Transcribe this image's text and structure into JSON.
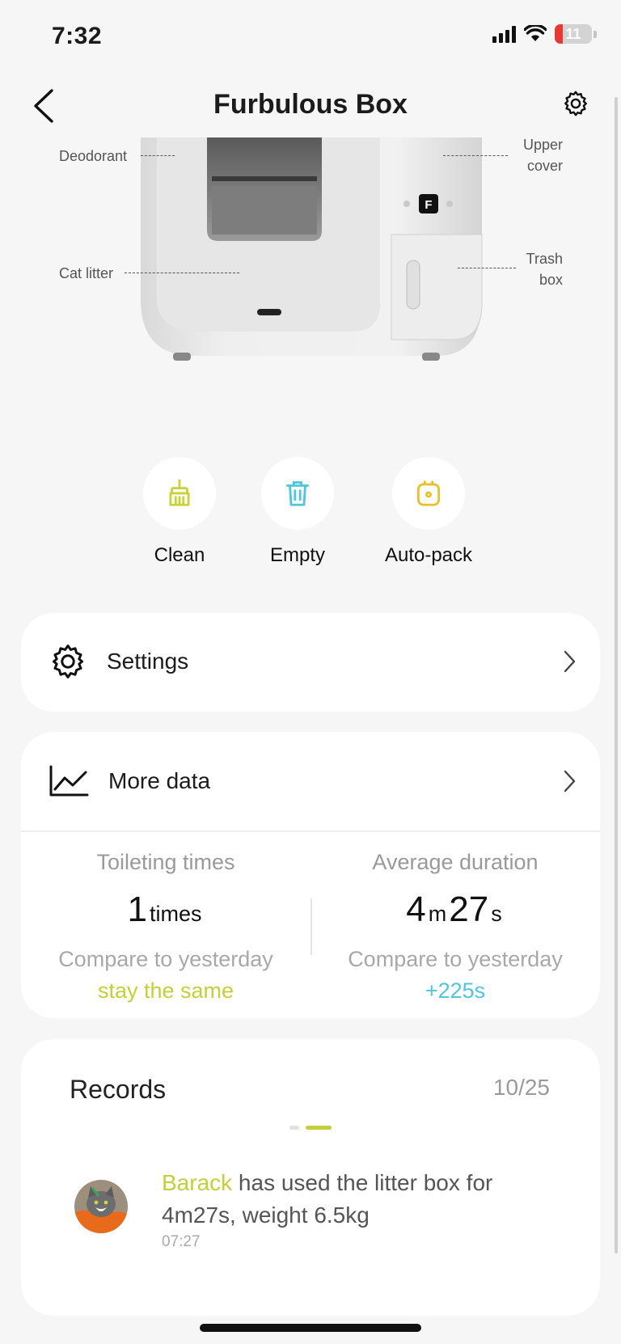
{
  "status": {
    "time": "7:32",
    "battery": "11"
  },
  "nav": {
    "title": "Furbulous Box"
  },
  "product": {
    "labels": {
      "deodorant": "Deodorant",
      "cat_litter": "Cat litter",
      "upper_cover": "Upper cover",
      "trash_box": "Trash box"
    },
    "panel_letter": "F"
  },
  "actions": [
    {
      "label": "Clean",
      "icon": "broom-icon",
      "color": "#c8d23a"
    },
    {
      "label": "Empty",
      "icon": "trash-icon",
      "color": "#4fc6da"
    },
    {
      "label": "Auto-pack",
      "icon": "auto-pack-icon",
      "color": "#e8c02e"
    }
  ],
  "menu": {
    "settings_label": "Settings",
    "more_data_label": "More data"
  },
  "stats": {
    "toileting": {
      "title": "Toileting times",
      "value": "1",
      "unit": "times",
      "compare": "Compare to yesterday",
      "delta": "stay the same",
      "delta_color": "#c4cf3a"
    },
    "duration": {
      "title": "Average duration",
      "minutes": "4",
      "minutes_unit": "m",
      "seconds": "27",
      "seconds_unit": "s",
      "compare": "Compare to yesterday",
      "delta": "+225s",
      "delta_color": "#4fc6da"
    }
  },
  "records": {
    "title": "Records",
    "date": "10/25",
    "items": [
      {
        "cat_name": "Barack",
        "text": " has used the litter box for 4m27s, weight 6.5kg",
        "time": "07:27",
        "name_color": "#c4cf3a"
      }
    ]
  }
}
